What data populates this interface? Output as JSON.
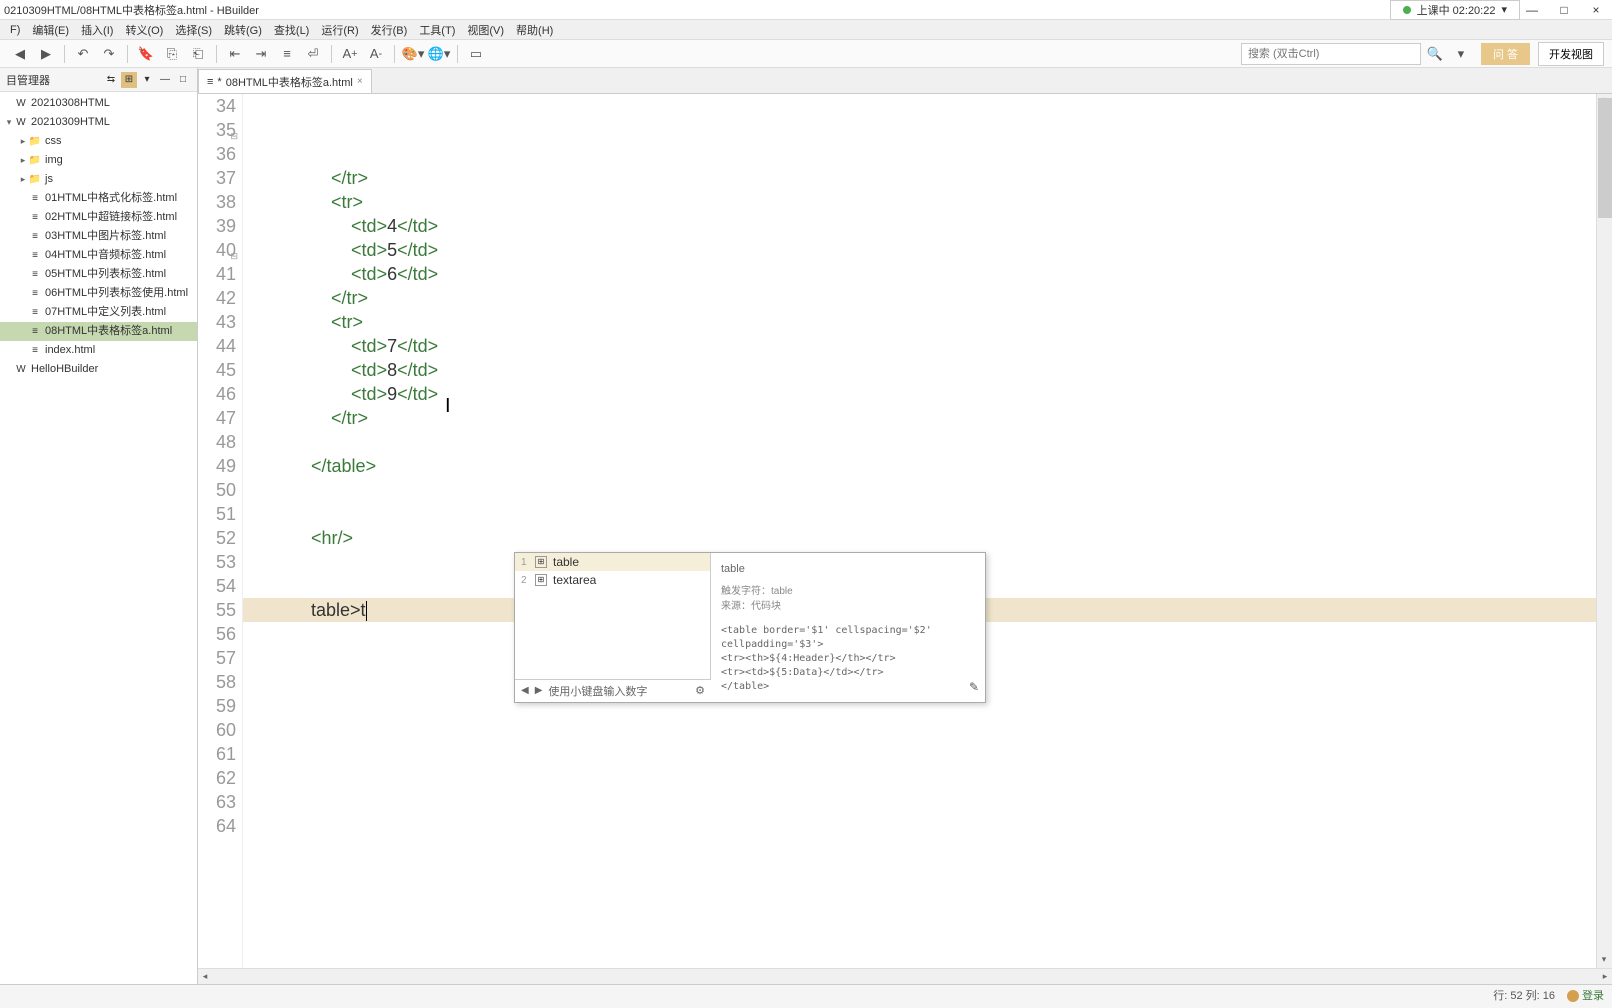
{
  "title": "0210309HTML/08HTML中表格标签a.html - HBuilder",
  "status": {
    "text": "上课中 02:20:22",
    "indicator": "●"
  },
  "winctl": {
    "min": "—",
    "max": "□",
    "close": "×"
  },
  "menu": [
    "F)",
    "编辑(E)",
    "插入(I)",
    "转义(O)",
    "选择(S)",
    "跳转(G)",
    "查找(L)",
    "运行(R)",
    "发行(B)",
    "工具(T)",
    "视图(V)",
    "帮助(H)"
  ],
  "toolbar": {
    "search_placeholder": "搜索 (双击Ctrl)",
    "answer": "问 答",
    "devview": "开发视图"
  },
  "sidebar": {
    "title": "目管理器",
    "toggleA": "⇆",
    "tree": [
      {
        "icon": "W",
        "label": "20210308HTML",
        "indent": 0,
        "expand": ""
      },
      {
        "icon": "W",
        "label": "20210309HTML",
        "indent": 0,
        "expand": "▾"
      },
      {
        "icon": "📁",
        "label": "css",
        "indent": 1,
        "expand": "▸"
      },
      {
        "icon": "📁",
        "label": "img",
        "indent": 1,
        "expand": "▸"
      },
      {
        "icon": "📁",
        "label": "js",
        "indent": 1,
        "expand": "▸"
      },
      {
        "icon": "≡",
        "label": "01HTML中格式化标签.html",
        "indent": 1,
        "expand": ""
      },
      {
        "icon": "≡",
        "label": "02HTML中超链接标签.html",
        "indent": 1,
        "expand": ""
      },
      {
        "icon": "≡",
        "label": "03HTML中图片标签.html",
        "indent": 1,
        "expand": ""
      },
      {
        "icon": "≡",
        "label": "04HTML中音频标签.html",
        "indent": 1,
        "expand": ""
      },
      {
        "icon": "≡",
        "label": "05HTML中列表标签.html",
        "indent": 1,
        "expand": ""
      },
      {
        "icon": "≡",
        "label": "06HTML中列表标签使用.html",
        "indent": 1,
        "expand": ""
      },
      {
        "icon": "≡",
        "label": "07HTML中定义列表.html",
        "indent": 1,
        "expand": ""
      },
      {
        "icon": "≡",
        "label": "08HTML中表格标签a.html",
        "indent": 1,
        "expand": "",
        "selected": true
      },
      {
        "icon": "≡",
        "label": "index.html",
        "indent": 1,
        "expand": ""
      },
      {
        "icon": "W",
        "label": "HelloHBuilder",
        "indent": 0,
        "expand": ""
      }
    ]
  },
  "tab": {
    "dirty": "*",
    "name": "08HTML中表格标签a.html",
    "close": "×"
  },
  "lines": {
    "start": 34,
    "folds": {
      "35": "⊟",
      "40": "⊟"
    },
    "content": [
      {
        "n": 34,
        "t": "                </tr>"
      },
      {
        "n": 35,
        "t": "                <tr>"
      },
      {
        "n": 36,
        "t": "                    <td>4</td>"
      },
      {
        "n": 37,
        "t": "                    <td>5</td>"
      },
      {
        "n": 38,
        "t": "                    <td>6</td>"
      },
      {
        "n": 39,
        "t": "                </tr>"
      },
      {
        "n": 40,
        "t": "                <tr>"
      },
      {
        "n": 41,
        "t": "                    <td>7</td>"
      },
      {
        "n": 42,
        "t": "                    <td>8</td>"
      },
      {
        "n": 43,
        "t": "                    <td>9</td>"
      },
      {
        "n": 44,
        "t": "                </tr>"
      },
      {
        "n": 45,
        "t": ""
      },
      {
        "n": 46,
        "t": "            </table>"
      },
      {
        "n": 47,
        "t": ""
      },
      {
        "n": 48,
        "t": ""
      },
      {
        "n": 49,
        "t": "            <hr/>"
      },
      {
        "n": 50,
        "t": ""
      },
      {
        "n": 51,
        "t": ""
      },
      {
        "n": 52,
        "t": "            table>t",
        "hl": true,
        "cursor": true
      },
      {
        "n": 53,
        "t": ""
      },
      {
        "n": 54,
        "t": ""
      },
      {
        "n": 55,
        "t": ""
      },
      {
        "n": 56,
        "t": ""
      },
      {
        "n": 57,
        "t": ""
      },
      {
        "n": 58,
        "t": ""
      },
      {
        "n": 59,
        "t": ""
      },
      {
        "n": 60,
        "t": ""
      },
      {
        "n": 61,
        "t": ""
      },
      {
        "n": 62,
        "t": ""
      },
      {
        "n": 63,
        "t": ""
      },
      {
        "n": 64,
        "t": ""
      }
    ]
  },
  "autocomplete": {
    "items": [
      {
        "n": "1",
        "label": "table",
        "sel": true
      },
      {
        "n": "2",
        "label": "textarea"
      }
    ],
    "footer": "使用小键盘输入数字",
    "detail": {
      "title": "table",
      "trigger": "触发字符：table",
      "source": "来源：代码块",
      "snippet": [
        "<table border='$1' cellspacing='$2' cellpadding='$3'>",
        "<tr><th>${4:Header}</th></tr>",
        "<tr><td>${5:Data}</td></tr>",
        "</table>"
      ]
    }
  },
  "statusbar": {
    "pos": "行: 52 列: 16",
    "login": "登录"
  }
}
